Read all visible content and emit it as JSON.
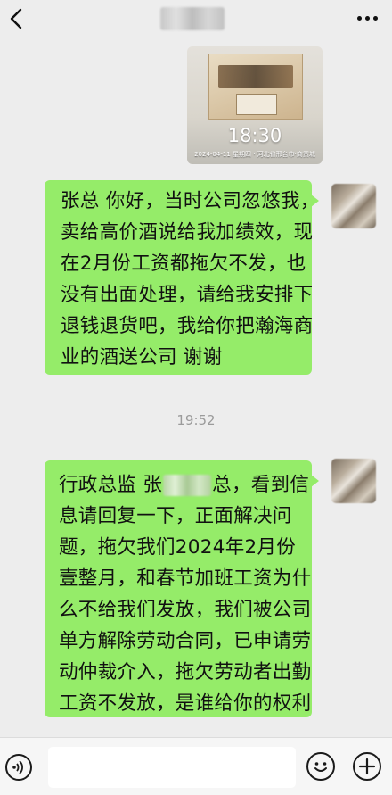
{
  "header": {
    "back_icon": "chevron-left-icon",
    "more_icon": "ellipsis-icon"
  },
  "messages": {
    "video": {
      "duration": "18:30",
      "meta": "2024-04-11 星期四 · 河北省邢台市·商贸城"
    },
    "first": {
      "lines": [
        "张总 你好，当时公司忽悠我，",
        "卖给高价酒说给我加绩效，现",
        "在2月份工资都拖欠不发，也",
        "没有出面处理，请给我安排下",
        "退钱退货吧，我给你把瀚海商",
        "业的酒送公司 谢谢"
      ]
    },
    "timestamp": "19:52",
    "second": {
      "line1_prefix": "行政总监 张",
      "line1_suffix": "总，看到信",
      "lines": [
        "息请回复一下，正面解决问",
        "题，拖欠我们2024年2月份",
        "壹整月，和春节加班工资为什",
        "么不给我们发放，我们被公司",
        "单方解除劳动合同，已申请劳",
        "动仲裁介入，拖欠劳动者出勤",
        "工资不发放，是谁给你的权利"
      ]
    }
  },
  "input_bar": {
    "voice_icon": "voice-icon",
    "emoji_icon": "emoji-icon",
    "plus_icon": "plus-icon",
    "placeholder": ""
  },
  "colors": {
    "bubble_green": "#95ec69",
    "background": "#ededed"
  }
}
